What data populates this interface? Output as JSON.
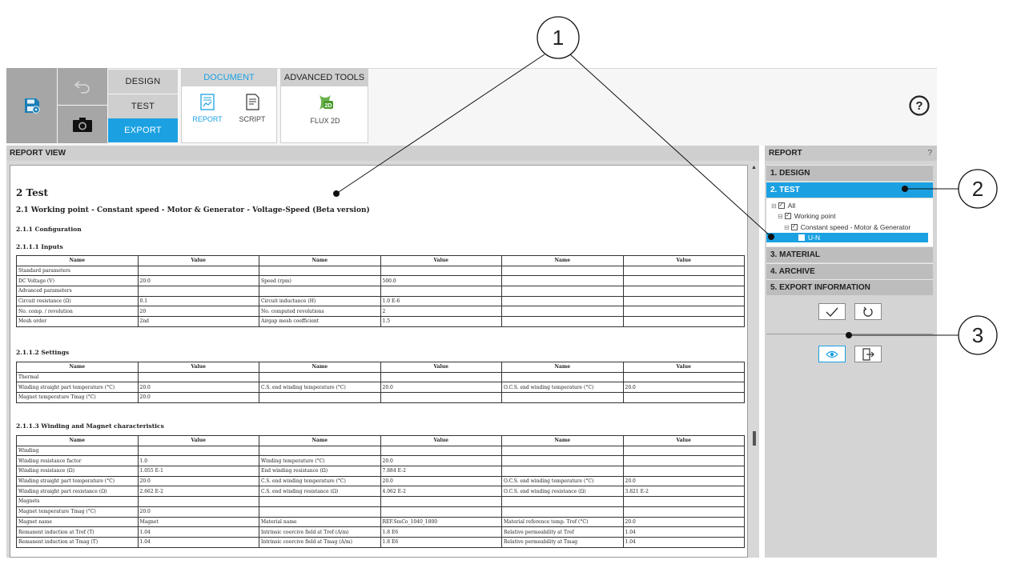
{
  "toolbar": {
    "modes": [
      "DESIGN",
      "TEST",
      "EXPORT"
    ],
    "document_group": {
      "title": "DOCUMENT",
      "tools": [
        "REPORT",
        "SCRIPT"
      ]
    },
    "advanced_group": {
      "title": "ADVANCED TOOLS",
      "tools": [
        "FLUX 2D"
      ],
      "icon_text": "2D"
    },
    "icons": {
      "save": "save-settings-icon",
      "undo": "undo-icon",
      "camera": "camera-icon",
      "report": "report-document-icon",
      "script": "script-document-icon",
      "flux": "flux-2d-icon",
      "help": "help-circle-icon"
    },
    "help_symbol": "?"
  },
  "report_view": {
    "header": "REPORT VIEW",
    "title": "2 Test",
    "subtitle": "2.1 Working point - Constant speed - Motor & Generator - Voltage-Speed (Beta version)",
    "config_heading": "2.1.1 Configuration",
    "inputs": {
      "heading": "2.1.1.1 Inputs",
      "columns": [
        "Name",
        "Value",
        "Name",
        "Value",
        "Name",
        "Value"
      ],
      "rows": [
        [
          "Standard parameters",
          "",
          "",
          "",
          "",
          ""
        ],
        [
          "DC Voltage (V)",
          "20.0",
          "Speed (rpm)",
          "500.0",
          "",
          ""
        ],
        [
          "Advanced parameters",
          "",
          "",
          "",
          "",
          ""
        ],
        [
          "Circuit resistance (Ω)",
          "0.1",
          "Circuit inductance (H)",
          "1.0 E-6",
          "",
          ""
        ],
        [
          "No. comp. / revolution",
          "20",
          "No. computed revolutions",
          "2",
          "",
          ""
        ],
        [
          "Mesh order",
          "2nd",
          "Airgap mesh coefficient",
          "1.5",
          "",
          ""
        ]
      ]
    },
    "settings": {
      "heading": "2.1.1.2 Settings",
      "columns": [
        "Name",
        "Value",
        "Name",
        "Value",
        "Name",
        "Value"
      ],
      "rows": [
        [
          "Thermal",
          "",
          "",
          "",
          "",
          ""
        ],
        [
          "Winding straight part temperature (°C)",
          "20.0",
          "C.S. end winding temperature (°C)",
          "20.0",
          "O.C.S. end winding temperature (°C)",
          "20.0"
        ],
        [
          "Magnet temperature Tmag (°C)",
          "20.0",
          "",
          "",
          "",
          ""
        ]
      ]
    },
    "winding": {
      "heading": "2.1.1.3 Winding and Magnet characteristics",
      "columns": [
        "Name",
        "Value",
        "Name",
        "Value",
        "Name",
        "Value"
      ],
      "rows": [
        [
          "Winding",
          "",
          "",
          "",
          "",
          ""
        ],
        [
          "Winding resistance factor",
          "1.0",
          "Winding temperature (°C)",
          "20.0",
          "",
          ""
        ],
        [
          "Winding resistance (Ω)",
          "1.055 E-1",
          "End winding resistance (Ω)",
          "7.884 E-2",
          "",
          ""
        ],
        [
          "Winding straight part temperature (°C)",
          "20.0",
          "C.S. end winding temperature (°C)",
          "20.0",
          "O.C.S. end winding temperature (°C)",
          "20.0"
        ],
        [
          "Winding straight part resistance (Ω)",
          "2.662 E-2",
          "C.S. end winding resistance (Ω)",
          "4.062 E-2",
          "O.C.S. end winding resistance (Ω)",
          "3.821 E-2"
        ],
        [
          "Magnets",
          "",
          "",
          "",
          "",
          ""
        ],
        [
          "Magnet temperature Tmag (°C)",
          "20.0",
          "",
          "",
          "",
          ""
        ],
        [
          "Magnet name",
          "Magnet",
          "Material name",
          "REF.SmCo_1040_1800",
          "Material reference temp. Tref (°C)",
          "20.0"
        ],
        [
          "Remanent induction at Tref (T)",
          "1.04",
          "Intrinsic coercive field at Tref (A/m)",
          "1.8 E6",
          "Relative permeability at Tref",
          "1.04"
        ],
        [
          "Remanent induction at Tmag (T)",
          "1.04",
          "Intrinsic coercive field at Tmag (A/m)",
          "1.8 E6",
          "Relative permeability at Tmag",
          "1.04"
        ]
      ]
    }
  },
  "report_panel": {
    "header": "REPORT",
    "help": "?",
    "sections": [
      "1. DESIGN",
      "2. TEST",
      "3. MATERIAL",
      "4. ARCHIVE",
      "5. EXPORT INFORMATION"
    ],
    "tree": {
      "all": "All",
      "working_point": "Working point",
      "constant_speed": "Constant speed - Motor & Generator",
      "un": "U-N"
    },
    "buttons": {
      "ok": "check-icon",
      "reset": "reset-icon",
      "preview": "preview-icon",
      "export": "export-icon"
    }
  },
  "callouts": [
    "1",
    "2",
    "3"
  ],
  "colors": {
    "accent": "#1ba1e2",
    "toolbar_gray": "#a6a6a6",
    "panel_gray": "#d4d4d4"
  }
}
